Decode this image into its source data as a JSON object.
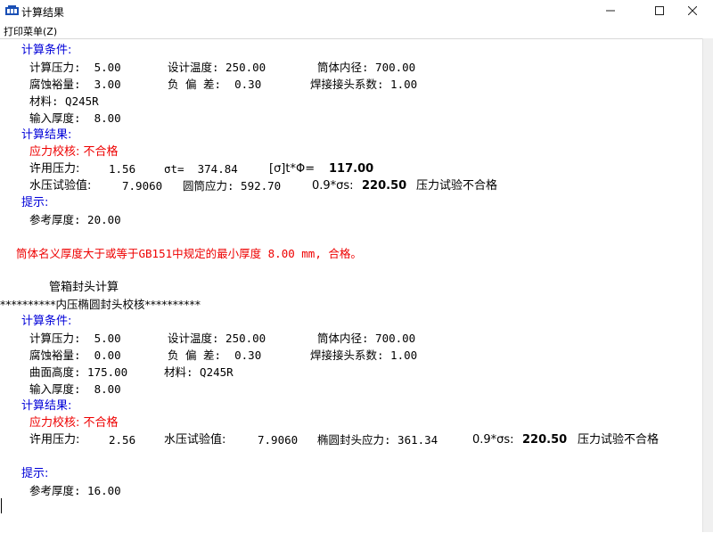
{
  "window": {
    "title": "计算结果",
    "icon": "app-logo-icon",
    "controls": [
      "minimize-icon",
      "maximize-icon",
      "close-icon"
    ]
  },
  "menu": {
    "print_label": "打印菜单(Z)"
  },
  "section1": {
    "cond_head": "计算条件:",
    "cond_l1_a": "计算压力:  5.00",
    "cond_l1_b": "设计温度: 250.00",
    "cond_l1_c": "筒体内径: 700.00",
    "cond_l2_a": "腐蚀裕量:  3.00",
    "cond_l2_b": "负 偏 差:  0.30",
    "cond_l2_c": "焊接接头系数: 1.00",
    "material": "材料: Q245R",
    "thickness": "输入厚度:  8.00",
    "result_head": "计算结果:",
    "stress_check": "应力校核: 不合格",
    "allow_p_label": "许用压力:",
    "allow_p_val": "1.56",
    "sigma_t": "σt=  374.84",
    "sigma_phi_label": "[σ]t*Φ=",
    "sigma_phi_val": "117.00",
    "hydro_label": "水压试验值:",
    "hydro_val": "7.9060",
    "cyl_stress": "圆筒应力: 592.70",
    "yield_label": "0.9*σs:",
    "yield_val": "220.50",
    "pressure_test": "压力试验不合格",
    "hint_head": "提示:",
    "ref_thickness": "参考厚度: 20.00",
    "note": "筒体名义厚度大于或等于GB151中规定的最小厚度 8.00 mm, 合格。"
  },
  "section2": {
    "title": "管箱封头计算",
    "banner": "**********内压椭圆封头校核**********",
    "cond_head": "计算条件:",
    "cond_l1_a": "计算压力:  5.00",
    "cond_l1_b": "设计温度: 250.00",
    "cond_l1_c": "筒体内径: 700.00",
    "cond_l2_a": "腐蚀裕量:  0.00",
    "cond_l2_b": "负 偏 差:  0.30",
    "cond_l2_c": "焊接接头系数: 1.00",
    "curve_height": "曲面高度: 175.00",
    "material": "材料: Q245R",
    "thickness": "输入厚度:  8.00",
    "result_head": "计算结果:",
    "stress_check": "应力校核: 不合格",
    "allow_p_label": "许用压力:",
    "allow_p_val": "2.56",
    "hydro_label": "水压试验值:",
    "hydro_val": "7.9060",
    "head_stress": "椭圆封头应力: 361.34",
    "yield_label": "0.9*σs:",
    "yield_val": "220.50",
    "pressure_test": "压力试验不合格",
    "hint_head": "提示:",
    "ref_thickness": "参考厚度: 16.00"
  },
  "colors": {
    "heading": "#0000d8",
    "warning": "#ee0000",
    "text": "#000000"
  }
}
